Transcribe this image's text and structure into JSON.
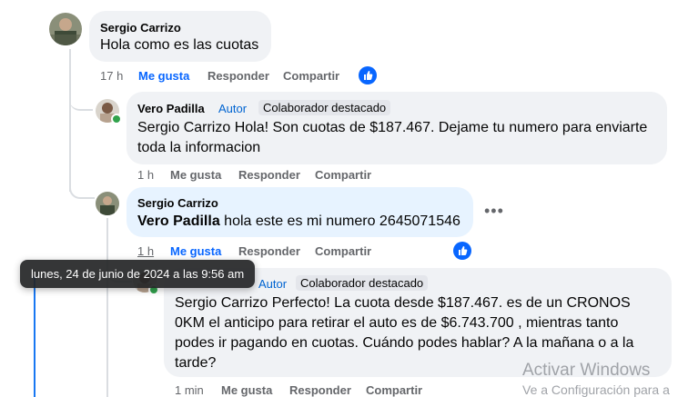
{
  "comments": [
    {
      "author": "Sergio Carrizo",
      "text": "Hola como es las cuotas",
      "time": "17 h",
      "like_label": "Me gusta",
      "reply_label": "Responder",
      "share_label": "Compartir"
    },
    {
      "author": "Vero Padilla",
      "badge": "Autor",
      "chip": "Colaborador destacado",
      "text_line1": "Sergio Carrizo Hola! Son cuotas de $187.467. Dejame tu numero para enviarte",
      "text_line2": "toda la informacion",
      "time": "1 h",
      "like_label": "Me gusta",
      "reply_label": "Responder",
      "share_label": "Compartir"
    },
    {
      "author": "Sergio Carrizo",
      "mention": "Vero Padilla",
      "text": " hola este es mi numero 2645071546",
      "time": "1 h",
      "like_label": "Me gusta",
      "reply_label": "Responder",
      "share_label": "Compartir"
    },
    {
      "badge": "Autor",
      "chip": "Colaborador destacado",
      "text_line1": "Sergio Carrizo Perfecto! La cuota desde $187.467. es de un CRONOS",
      "text_line2": "0KM el anticipo para retirar el auto es de $6.743.700 , mientras tanto",
      "text_line3": "podes ir pagando en cuotas. Cuándo podes hablar? A la mañana o a la",
      "text_line4": "tarde?",
      "time": "1 min",
      "like_label": "Me gusta",
      "reply_label": "Responder",
      "share_label": "Compartir"
    }
  ],
  "tooltip": "lunes, 24 de junio de 2024 a las 9:56 am",
  "watermark": {
    "line1": "Activar Windows",
    "line2": "Ve a Configuración para a"
  },
  "colors": {
    "accent": "#0866ff",
    "bubble": "#f0f2f5",
    "bubble_selected": "#e7f3ff",
    "muted": "#65676b"
  },
  "icons": {
    "like": "thumbs-up-icon",
    "more": "more-options-icon"
  }
}
